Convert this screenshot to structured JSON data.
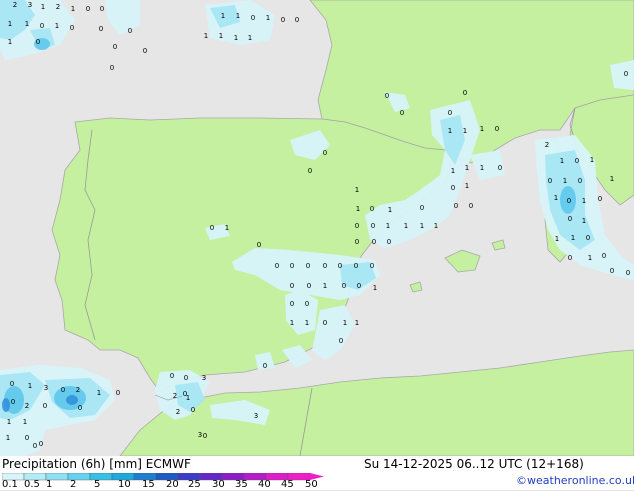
{
  "footer": {
    "title": "Precipitation (6h) [mm] ECMWF",
    "valid": "Su 14-12-2025 06..12 UTC (12+168)",
    "credit": "©weatheronline.co.uk"
  },
  "legend": {
    "ticks": [
      "0.1",
      "0.5",
      "1",
      "2",
      "5",
      "10",
      "15",
      "20",
      "25",
      "30",
      "35",
      "40",
      "45",
      "50"
    ],
    "colors": [
      "#d8f4fa",
      "#b4ecf6",
      "#8ee0f2",
      "#66d2ee",
      "#38bfe6",
      "#1ea8dc",
      "#1e7fd0",
      "#1e5ac4",
      "#3c3cc8",
      "#6428c8",
      "#8c1ec8",
      "#b41ec8",
      "#dc1ec8",
      "#f01ec8"
    ]
  },
  "colors": {
    "land": "#c4f0a0",
    "sea": "#e6e6e6",
    "border": "#9a9a9a",
    "coast": "#a8a8a8",
    "precip_light": "#d8f4fa",
    "precip_mid": "#a8e6f4",
    "precip_heavy": "#5fc8ec"
  },
  "map_values": [
    {
      "v": "2"
    },
    {
      "v": "3"
    },
    {
      "v": "1"
    },
    {
      "v": "2"
    },
    {
      "v": "1"
    },
    {
      "v": "0"
    },
    {
      "v": "0"
    },
    {
      "v": "1"
    },
    {
      "v": "1"
    },
    {
      "v": "0"
    },
    {
      "v": "1"
    },
    {
      "v": "0"
    },
    {
      "v": "1"
    },
    {
      "v": "0"
    },
    {
      "v": "1"
    },
    {
      "v": "1"
    },
    {
      "v": "0"
    },
    {
      "v": "1"
    },
    {
      "v": "0"
    },
    {
      "v": "0"
    },
    {
      "v": "0"
    },
    {
      "v": "0"
    },
    {
      "v": "0"
    },
    {
      "v": "0"
    },
    {
      "v": "1"
    },
    {
      "v": "1"
    },
    {
      "v": "1"
    },
    {
      "v": "1"
    },
    {
      "v": "0"
    },
    {
      "v": "0"
    },
    {
      "v": "0"
    },
    {
      "v": "0"
    },
    {
      "v": "0"
    },
    {
      "v": "1"
    },
    {
      "v": "1"
    },
    {
      "v": "1"
    },
    {
      "v": "0"
    },
    {
      "v": "0"
    },
    {
      "v": "0"
    },
    {
      "v": "1"
    },
    {
      "v": "1"
    },
    {
      "v": "0"
    },
    {
      "v": "1"
    },
    {
      "v": "1"
    },
    {
      "v": "1"
    },
    {
      "v": "0"
    },
    {
      "v": "0"
    },
    {
      "v": "1"
    },
    {
      "v": "2"
    },
    {
      "v": "1"
    },
    {
      "v": "0"
    },
    {
      "v": "1"
    },
    {
      "v": "0"
    },
    {
      "v": "1"
    },
    {
      "v": "0"
    },
    {
      "v": "1"
    },
    {
      "v": "0"
    },
    {
      "v": "1"
    },
    {
      "v": "1"
    },
    {
      "v": "0"
    },
    {
      "v": "0"
    },
    {
      "v": "1"
    },
    {
      "v": "1"
    },
    {
      "v": "0"
    },
    {
      "v": "1"
    },
    {
      "v": "1"
    },
    {
      "v": "1"
    },
    {
      "v": "1"
    },
    {
      "v": "0"
    },
    {
      "v": "0"
    },
    {
      "v": "0"
    },
    {
      "v": "0"
    },
    {
      "v": "0"
    },
    {
      "v": "0"
    },
    {
      "v": "0"
    },
    {
      "v": "1"
    },
    {
      "v": "0"
    },
    {
      "v": "1"
    },
    {
      "v": "0"
    },
    {
      "v": "0"
    },
    {
      "v": "1"
    },
    {
      "v": "0"
    },
    {
      "v": "0"
    },
    {
      "v": "0"
    },
    {
      "v": "0"
    },
    {
      "v": "1"
    },
    {
      "v": "0"
    },
    {
      "v": "0"
    },
    {
      "v": "0"
    },
    {
      "v": "0"
    },
    {
      "v": "0"
    },
    {
      "v": "0"
    },
    {
      "v": "0"
    },
    {
      "v": "0"
    },
    {
      "v": "0"
    },
    {
      "v": "0"
    },
    {
      "v": "0"
    },
    {
      "v": "1"
    },
    {
      "v": "0"
    },
    {
      "v": "1"
    },
    {
      "v": "0"
    },
    {
      "v": "0"
    },
    {
      "v": "1"
    },
    {
      "v": "1"
    },
    {
      "v": "0"
    },
    {
      "v": "1"
    },
    {
      "v": "1"
    },
    {
      "v": "0"
    },
    {
      "v": "0"
    },
    {
      "v": "0"
    },
    {
      "v": "0"
    },
    {
      "v": "3"
    },
    {
      "v": "2"
    },
    {
      "v": "1"
    },
    {
      "v": "2"
    },
    {
      "v": "3"
    },
    {
      "v": "3"
    },
    {
      "v": "0"
    },
    {
      "v": "1"
    },
    {
      "v": "3"
    },
    {
      "v": "0"
    },
    {
      "v": "2"
    },
    {
      "v": "1"
    },
    {
      "v": "0"
    },
    {
      "v": "0"
    },
    {
      "v": "2"
    },
    {
      "v": "0"
    },
    {
      "v": "0"
    },
    {
      "v": "1"
    },
    {
      "v": "1"
    },
    {
      "v": "0"
    },
    {
      "v": "0"
    },
    {
      "v": "1"
    },
    {
      "v": "0"
    },
    {
      "v": "0"
    },
    {
      "v": "0"
    },
    {
      "v": "0"
    }
  ]
}
